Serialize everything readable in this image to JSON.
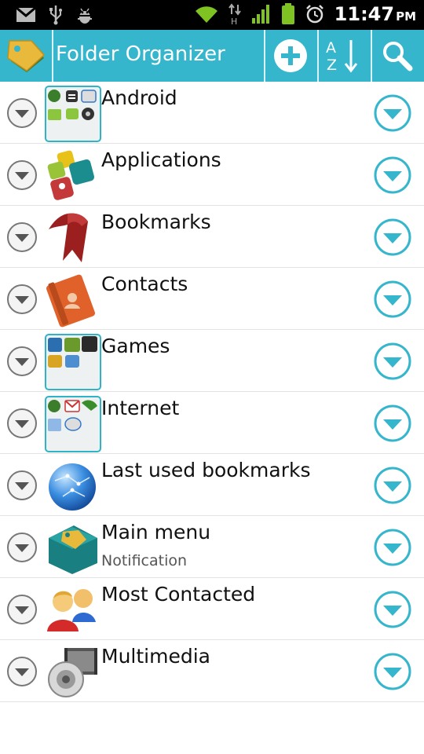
{
  "status_bar": {
    "time": "11:47",
    "ampm": "PM",
    "icons": [
      "gmail-icon",
      "usb-icon",
      "android-debug-icon",
      "wifi-icon",
      "data-transfer-icon",
      "signal-icon",
      "battery-icon",
      "alarm-icon"
    ]
  },
  "app_bar": {
    "title": "Folder Organizer",
    "icon": "folder-organizer-tag-icon",
    "actions": [
      "add-icon",
      "sort-az-icon",
      "search-icon"
    ]
  },
  "colors": {
    "accent": "#35b6cc",
    "statusbar_bg": "#000000",
    "row_divider": "#e3e3e3"
  },
  "items": [
    {
      "label": "Android",
      "sub": "",
      "icon": "android-folder-icon"
    },
    {
      "label": "Applications",
      "sub": "",
      "icon": "applications-blocks-icon"
    },
    {
      "label": "Bookmarks",
      "sub": "",
      "icon": "bookmark-ribbon-icon"
    },
    {
      "label": "Contacts",
      "sub": "",
      "icon": "contacts-book-icon"
    },
    {
      "label": "Games",
      "sub": "",
      "icon": "games-folder-icon"
    },
    {
      "label": "Internet",
      "sub": "",
      "icon": "internet-folder-icon"
    },
    {
      "label": "Last used bookmarks",
      "sub": "",
      "icon": "globe-icon"
    },
    {
      "label": "Main menu",
      "sub": "Notification",
      "icon": "main-menu-folder-icon"
    },
    {
      "label": "Most Contacted",
      "sub": "",
      "icon": "people-icon"
    },
    {
      "label": "Multimedia",
      "sub": "",
      "icon": "multimedia-speaker-icon"
    }
  ]
}
